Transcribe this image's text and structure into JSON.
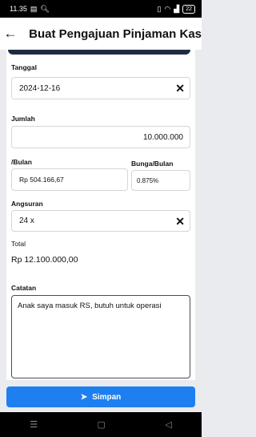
{
  "status": {
    "time": "11.35",
    "battery": "22"
  },
  "appbar": {
    "title": "Buat Pengajuan Pinjaman Kas"
  },
  "form": {
    "tanggal_label": "Tanggal",
    "tanggal_value": "2024-12-16",
    "jumlah_label": "Jumlah",
    "jumlah_value": "10.000.000",
    "bulan_label": "/Bulan",
    "bulan_value": "Rp 504.166,67",
    "bunga_label": "Bunga/Bulan",
    "bunga_value": "0.875%",
    "angsuran_label": "Angsuran",
    "angsuran_value": "24 x",
    "total_label": "Total",
    "total_value": "Rp 12.100.000,00",
    "catatan_label": "Catatan",
    "catatan_value": "Anak saya masuk RS, butuh untuk operasi"
  },
  "save_label": "Simpan"
}
